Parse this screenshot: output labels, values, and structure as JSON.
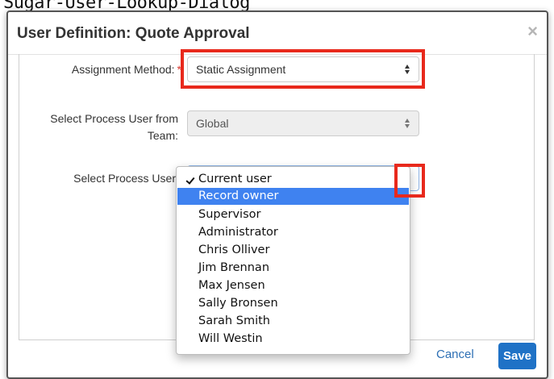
{
  "caption": "Sugar-User-Lookup-Dialog",
  "dialog": {
    "title": "User Definition: Quote Approval",
    "close_symbol": "×"
  },
  "form": {
    "assignment_method": {
      "label": "Assignment Method:",
      "required_mark": "*",
      "value": "Static Assignment"
    },
    "team": {
      "label_line1": "Select Process User from",
      "label_line2": "Team:",
      "value": "Global"
    },
    "process_user": {
      "label": "Select Process User",
      "options": [
        "Current user",
        "Record owner",
        "Supervisor",
        "Administrator",
        "Chris Olliver",
        "Jim Brennan",
        "Max Jensen",
        "Sally Bronsen",
        "Sarah Smith",
        "Will Westin"
      ],
      "checked_option": "Current user",
      "hovered_option": "Record owner"
    }
  },
  "footer": {
    "cancel_label": "Cancel",
    "save_label": "Save"
  },
  "colors": {
    "highlight": "#e8291c",
    "accent": "#1f72c6",
    "menu_selected": "#3f82f0"
  }
}
